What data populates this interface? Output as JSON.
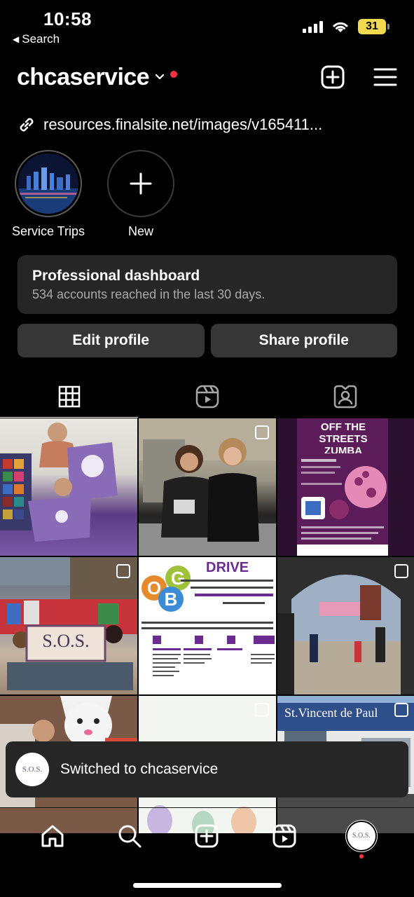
{
  "status_bar": {
    "time": "10:58",
    "back_label": "Search",
    "battery": "31"
  },
  "header": {
    "username": "chcaservice"
  },
  "bio": {
    "link": "resources.finalsite.net/images/v165411..."
  },
  "highlights": [
    {
      "label": "Service Trips",
      "icon": "highlight-cover"
    },
    {
      "label": "New",
      "icon": "plus-icon"
    }
  ],
  "dashboard": {
    "title": "Professional dashboard",
    "subtitle": "534 accounts reached in the last 30 days."
  },
  "buttons": {
    "edit": "Edit profile",
    "share": "Share profile"
  },
  "tabs": [
    "grid-icon",
    "reels-icon",
    "tagged-icon"
  ],
  "posts": {
    "p3_title": "OFF THE STREETS ZUMBA FUNRAISER",
    "p5_title": "DRIVE",
    "p5_letters": [
      "O",
      "G",
      "B"
    ]
  },
  "toast": {
    "avatar_text": "S.O.S.",
    "text": "Switched to chcaservice"
  },
  "nav": {
    "avatar_text": "S.O.S."
  },
  "colors": {
    "background": "#000000",
    "card": "#262626",
    "button": "#363636",
    "notification_red": "#ff3040"
  }
}
